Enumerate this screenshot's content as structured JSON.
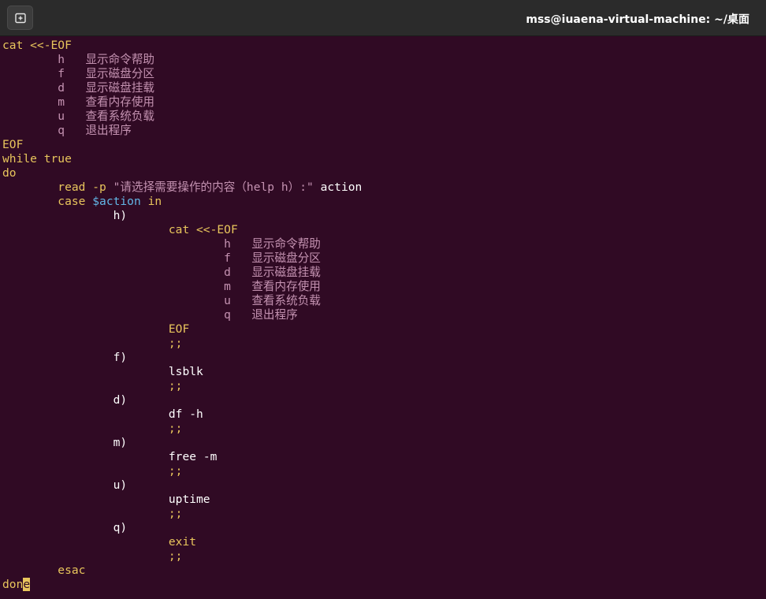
{
  "window": {
    "title": "mss@iuaena-virtual-machine: ~/桌面",
    "new_tab_icon": "new-tab-icon"
  },
  "editor": {
    "l1_cat": "cat <<-EOF",
    "menu": [
      {
        "key": "h",
        "text": "显示命令帮助"
      },
      {
        "key": "f",
        "text": "显示磁盘分区"
      },
      {
        "key": "d",
        "text": "显示磁盘挂载"
      },
      {
        "key": "m",
        "text": "查看内存使用"
      },
      {
        "key": "u",
        "text": "查看系统负载"
      },
      {
        "key": "q",
        "text": "退出程序"
      }
    ],
    "eof": "EOF",
    "while_true": "while true",
    "do": "do",
    "read_cmd": "read -p",
    "read_prompt": "\"请选择需要操作的内容（help h）:\"",
    "read_var": "action",
    "case_kw": "case",
    "case_var": "$action",
    "in_kw": "in",
    "case_h": "h)",
    "inner_cat": "cat <<-EOF",
    "dsemi": ";;",
    "case_f": "f)",
    "cmd_f": "lsblk",
    "case_d": "d)",
    "cmd_d_name": "df",
    "cmd_d_opt": "-h",
    "case_m": "m)",
    "cmd_m_name": "free",
    "cmd_m_opt": "-m",
    "case_u": "u)",
    "cmd_u": "uptime",
    "case_q": "q)",
    "cmd_q": "exit",
    "esac": "esac",
    "done_prefix": "don",
    "done_cursor": "e"
  },
  "colors": {
    "background": "#300a24",
    "keyword": "#e8c55c",
    "heredoc": "#c492b1",
    "variable": "#62b6e6"
  }
}
